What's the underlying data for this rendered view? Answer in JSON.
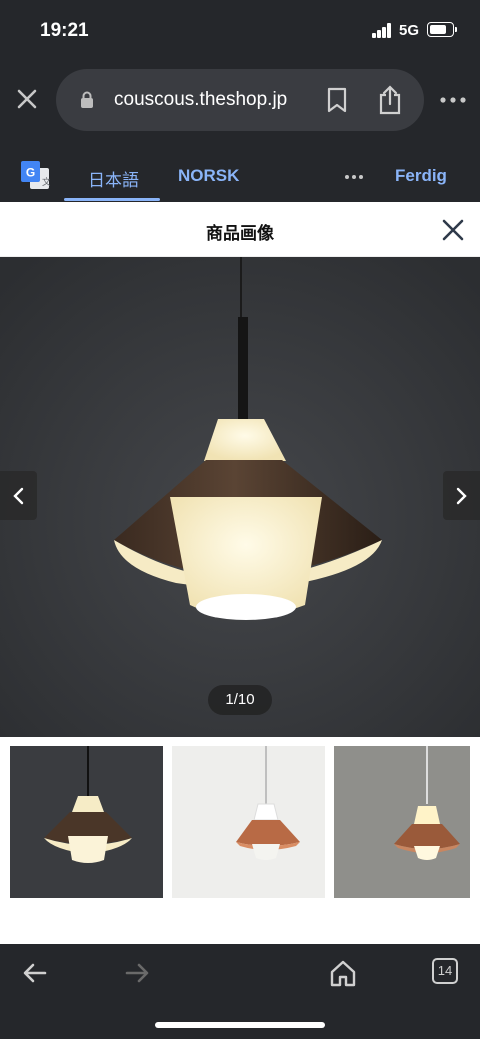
{
  "status": {
    "time": "19:21",
    "network": "5G"
  },
  "browser": {
    "url": "couscous.theshop.jp",
    "icons": [
      "close-icon",
      "lock-icon",
      "bookmark-icon",
      "share-icon",
      "more-icon"
    ]
  },
  "translate": {
    "tabs": [
      "日本語",
      "NORSK"
    ],
    "selected": "日本語",
    "done_label": "Ferdig",
    "accent": "#8ab4f8"
  },
  "modal": {
    "title": "商品画像",
    "counter": "1/10"
  },
  "bottom_nav": {
    "tab_count": "14",
    "icons": [
      "back-icon",
      "forward-icon",
      "home-icon",
      "tabs-icon"
    ]
  },
  "colors": {
    "chrome": "#25272b",
    "pill": "#3a3c41"
  }
}
